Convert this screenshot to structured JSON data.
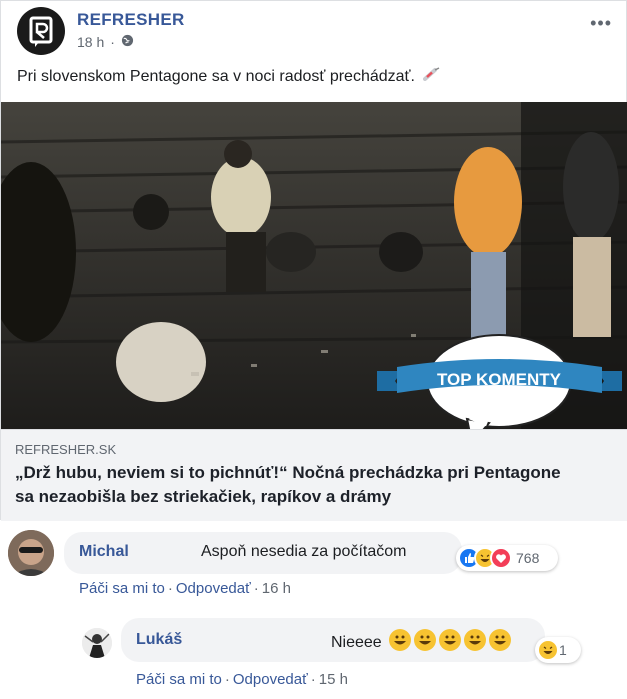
{
  "post": {
    "page_name": "REFRESHER",
    "time": "18 h",
    "separator": "·",
    "privacy_icon": "globe-icon",
    "more_icon": "•••",
    "text": "Pri slovenskom Pentagone sa v noci radosť prechádzať.",
    "text_emoji": "syringe-emoji",
    "badge_text": "TOP KOMENTY",
    "link": {
      "domain": "REFRESHER.SK",
      "title": "„Drž hubu, neviem si to pichnúť!“ Nočná prechádzka pri Pentagone sa nezaobišla bez striekačiek, rapíkov a drámy"
    }
  },
  "comments": [
    {
      "author": "Michal",
      "text": "Aspoň nesedia za počítačom",
      "reactions": [
        "like",
        "haha",
        "love"
      ],
      "reaction_count": "768",
      "actions": {
        "like": "Páči sa mi to",
        "reply": "Odpovedať",
        "time": "16 h"
      }
    },
    {
      "author": "Lukáš",
      "text": "Nieeee",
      "emoji_count": 5,
      "reactions": [
        "haha"
      ],
      "reaction_count": "1",
      "actions": {
        "like": "Páči sa mi to",
        "reply": "Odpovedať",
        "time": "15 h"
      }
    }
  ],
  "colors": {
    "link_blue": "#385898",
    "badge_blue": "#2f86c0",
    "bubble": "#f2f3f5",
    "like": "#1877f2",
    "love": "#f33e58",
    "haha": "#f7c331"
  }
}
